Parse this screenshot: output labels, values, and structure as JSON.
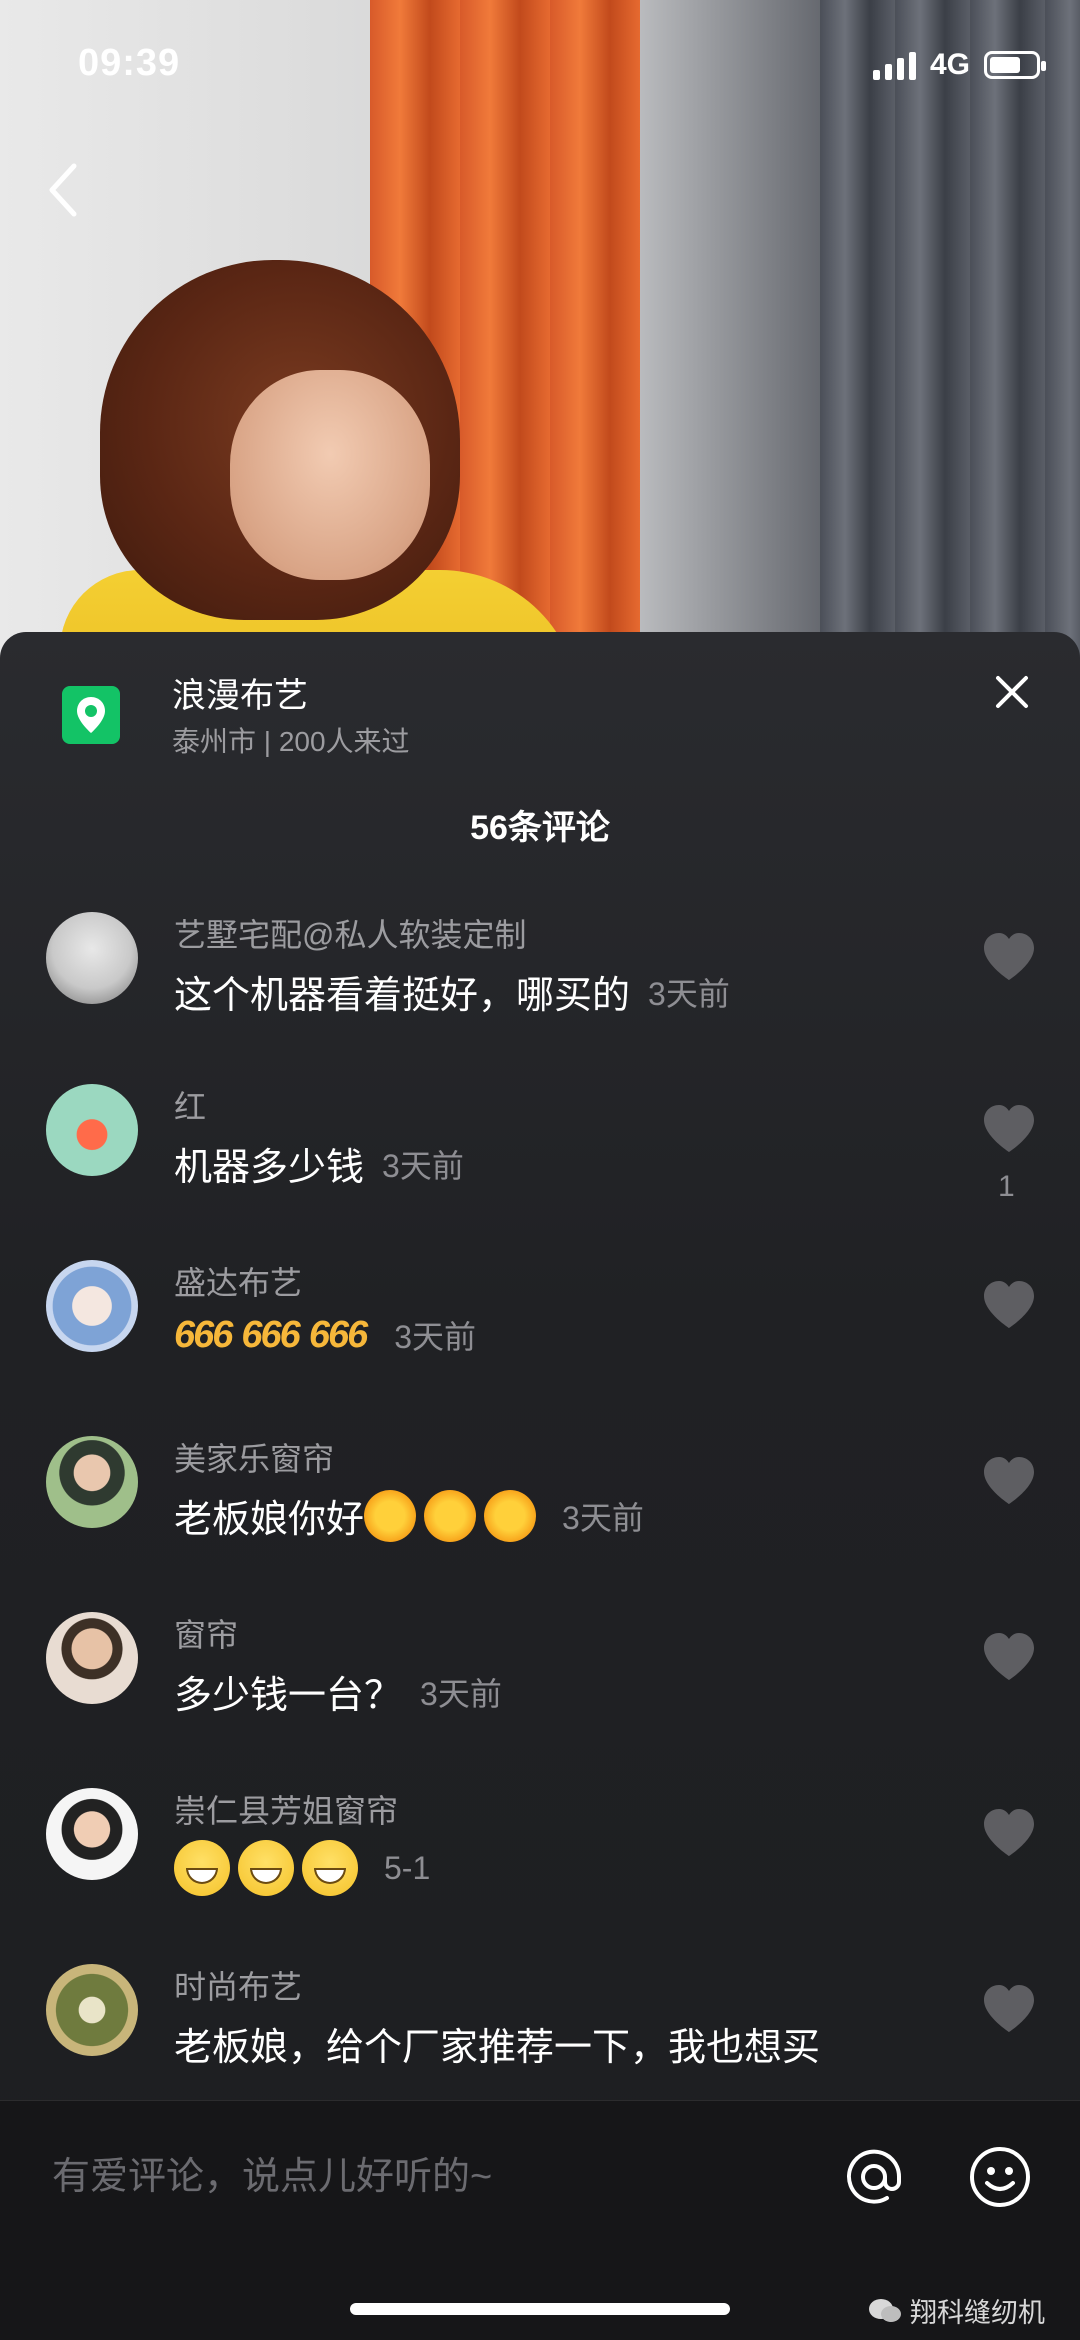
{
  "status_bar": {
    "time": "09:39",
    "network": "4G"
  },
  "location": {
    "name": "浪漫布艺",
    "subtitle": "泰州市 | 200人来过"
  },
  "comments_header": "56条评论",
  "comments": [
    {
      "user": "艺墅宅配@私人软装定制",
      "text": "这个机器看着挺好，哪买的",
      "time": "3天前",
      "likes": ""
    },
    {
      "user": "红",
      "text": "机器多少钱",
      "time": "3天前",
      "likes": "1"
    },
    {
      "user": "盛达布艺",
      "text": "",
      "time": "3天前",
      "likes": "",
      "emojis": [
        "666",
        "666",
        "666"
      ]
    },
    {
      "user": "美家乐窗帘",
      "text": "老板娘你好",
      "time": "3天前",
      "likes": "",
      "emojis": [
        "sun",
        "sun",
        "sun"
      ]
    },
    {
      "user": "窗帘",
      "text": "多少钱一台？",
      "time": "3天前",
      "likes": ""
    },
    {
      "user": "崇仁县芳姐窗帘",
      "text": "",
      "time": "5-1",
      "likes": "",
      "emojis": [
        "grin",
        "grin",
        "grin"
      ]
    },
    {
      "user": "时尚布艺",
      "text": "老板娘，给个厂家推荐一下，我也想买",
      "time": "",
      "likes": ""
    }
  ],
  "input": {
    "placeholder": "有爱评论，说点儿好听的~"
  },
  "watermark": "翔科缝纫机",
  "colors": {
    "location_green": "#13c366",
    "panel_bg": "#202124",
    "secondary_text": "#9c9ca0"
  }
}
